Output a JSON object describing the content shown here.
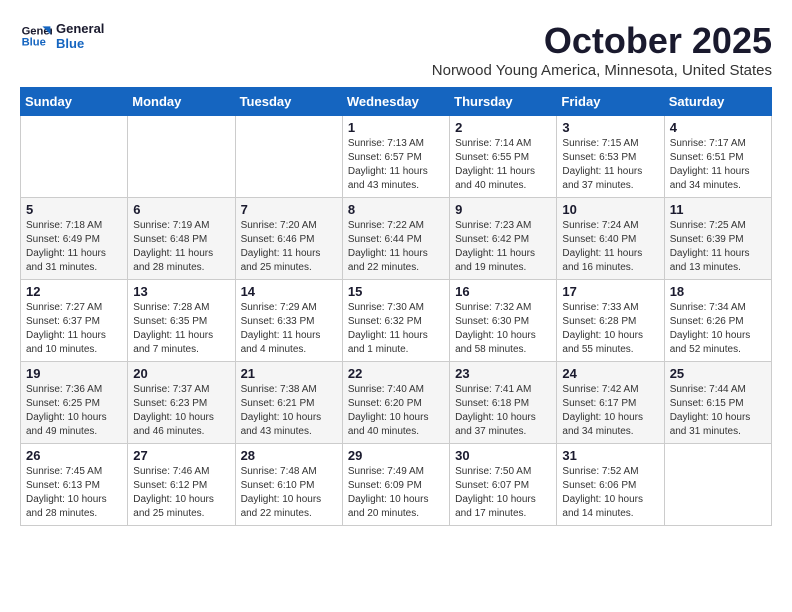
{
  "logo": {
    "line1": "General",
    "line2": "Blue"
  },
  "title": "October 2025",
  "subtitle": "Norwood Young America, Minnesota, United States",
  "days_of_week": [
    "Sunday",
    "Monday",
    "Tuesday",
    "Wednesday",
    "Thursday",
    "Friday",
    "Saturday"
  ],
  "weeks": [
    [
      {
        "day": "",
        "info": ""
      },
      {
        "day": "",
        "info": ""
      },
      {
        "day": "",
        "info": ""
      },
      {
        "day": "1",
        "info": "Sunrise: 7:13 AM\nSunset: 6:57 PM\nDaylight: 11 hours and 43 minutes."
      },
      {
        "day": "2",
        "info": "Sunrise: 7:14 AM\nSunset: 6:55 PM\nDaylight: 11 hours and 40 minutes."
      },
      {
        "day": "3",
        "info": "Sunrise: 7:15 AM\nSunset: 6:53 PM\nDaylight: 11 hours and 37 minutes."
      },
      {
        "day": "4",
        "info": "Sunrise: 7:17 AM\nSunset: 6:51 PM\nDaylight: 11 hours and 34 minutes."
      }
    ],
    [
      {
        "day": "5",
        "info": "Sunrise: 7:18 AM\nSunset: 6:49 PM\nDaylight: 11 hours and 31 minutes."
      },
      {
        "day": "6",
        "info": "Sunrise: 7:19 AM\nSunset: 6:48 PM\nDaylight: 11 hours and 28 minutes."
      },
      {
        "day": "7",
        "info": "Sunrise: 7:20 AM\nSunset: 6:46 PM\nDaylight: 11 hours and 25 minutes."
      },
      {
        "day": "8",
        "info": "Sunrise: 7:22 AM\nSunset: 6:44 PM\nDaylight: 11 hours and 22 minutes."
      },
      {
        "day": "9",
        "info": "Sunrise: 7:23 AM\nSunset: 6:42 PM\nDaylight: 11 hours and 19 minutes."
      },
      {
        "day": "10",
        "info": "Sunrise: 7:24 AM\nSunset: 6:40 PM\nDaylight: 11 hours and 16 minutes."
      },
      {
        "day": "11",
        "info": "Sunrise: 7:25 AM\nSunset: 6:39 PM\nDaylight: 11 hours and 13 minutes."
      }
    ],
    [
      {
        "day": "12",
        "info": "Sunrise: 7:27 AM\nSunset: 6:37 PM\nDaylight: 11 hours and 10 minutes."
      },
      {
        "day": "13",
        "info": "Sunrise: 7:28 AM\nSunset: 6:35 PM\nDaylight: 11 hours and 7 minutes."
      },
      {
        "day": "14",
        "info": "Sunrise: 7:29 AM\nSunset: 6:33 PM\nDaylight: 11 hours and 4 minutes."
      },
      {
        "day": "15",
        "info": "Sunrise: 7:30 AM\nSunset: 6:32 PM\nDaylight: 11 hours and 1 minute."
      },
      {
        "day": "16",
        "info": "Sunrise: 7:32 AM\nSunset: 6:30 PM\nDaylight: 10 hours and 58 minutes."
      },
      {
        "day": "17",
        "info": "Sunrise: 7:33 AM\nSunset: 6:28 PM\nDaylight: 10 hours and 55 minutes."
      },
      {
        "day": "18",
        "info": "Sunrise: 7:34 AM\nSunset: 6:26 PM\nDaylight: 10 hours and 52 minutes."
      }
    ],
    [
      {
        "day": "19",
        "info": "Sunrise: 7:36 AM\nSunset: 6:25 PM\nDaylight: 10 hours and 49 minutes."
      },
      {
        "day": "20",
        "info": "Sunrise: 7:37 AM\nSunset: 6:23 PM\nDaylight: 10 hours and 46 minutes."
      },
      {
        "day": "21",
        "info": "Sunrise: 7:38 AM\nSunset: 6:21 PM\nDaylight: 10 hours and 43 minutes."
      },
      {
        "day": "22",
        "info": "Sunrise: 7:40 AM\nSunset: 6:20 PM\nDaylight: 10 hours and 40 minutes."
      },
      {
        "day": "23",
        "info": "Sunrise: 7:41 AM\nSunset: 6:18 PM\nDaylight: 10 hours and 37 minutes."
      },
      {
        "day": "24",
        "info": "Sunrise: 7:42 AM\nSunset: 6:17 PM\nDaylight: 10 hours and 34 minutes."
      },
      {
        "day": "25",
        "info": "Sunrise: 7:44 AM\nSunset: 6:15 PM\nDaylight: 10 hours and 31 minutes."
      }
    ],
    [
      {
        "day": "26",
        "info": "Sunrise: 7:45 AM\nSunset: 6:13 PM\nDaylight: 10 hours and 28 minutes."
      },
      {
        "day": "27",
        "info": "Sunrise: 7:46 AM\nSunset: 6:12 PM\nDaylight: 10 hours and 25 minutes."
      },
      {
        "day": "28",
        "info": "Sunrise: 7:48 AM\nSunset: 6:10 PM\nDaylight: 10 hours and 22 minutes."
      },
      {
        "day": "29",
        "info": "Sunrise: 7:49 AM\nSunset: 6:09 PM\nDaylight: 10 hours and 20 minutes."
      },
      {
        "day": "30",
        "info": "Sunrise: 7:50 AM\nSunset: 6:07 PM\nDaylight: 10 hours and 17 minutes."
      },
      {
        "day": "31",
        "info": "Sunrise: 7:52 AM\nSunset: 6:06 PM\nDaylight: 10 hours and 14 minutes."
      },
      {
        "day": "",
        "info": ""
      }
    ]
  ]
}
